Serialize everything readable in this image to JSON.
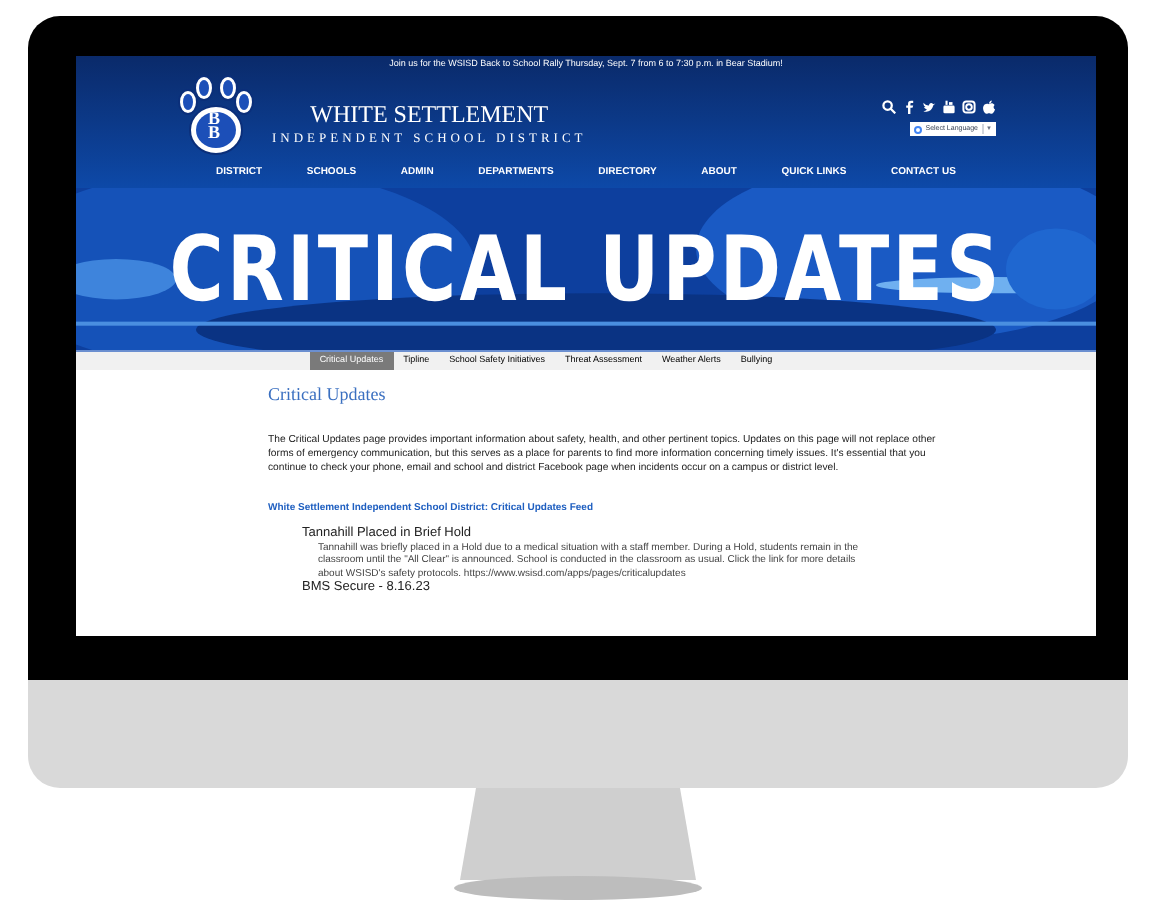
{
  "announcement": "Join us for the WSISD Back to School Rally Thursday, Sept. 7 from 6 to 7:30 p.m. in Bear Stadium!",
  "logo": {
    "letters": "BB"
  },
  "site_title": "WHITE SETTLEMENT",
  "site_subtitle": "INDEPENDENT SCHOOL DISTRICT",
  "language_select": {
    "value": "Select Language",
    "caret": "▼"
  },
  "nav": [
    "DISTRICT",
    "SCHOOLS",
    "ADMIN",
    "DEPARTMENTS",
    "DIRECTORY",
    "ABOUT",
    "QUICK LINKS",
    "CONTACT US"
  ],
  "hero_title": "CRITICAL UPDATES",
  "subnav": [
    {
      "label": "Critical Updates",
      "selected": true
    },
    {
      "label": "Tipline",
      "selected": false
    },
    {
      "label": "School Safety Initiatives",
      "selected": false
    },
    {
      "label": "Threat Assessment",
      "selected": false
    },
    {
      "label": "Weather Alerts",
      "selected": false
    },
    {
      "label": "Bullying",
      "selected": false
    }
  ],
  "page_heading": "Critical Updates",
  "intro": "The Critical Updates page provides important information about safety, health, and other pertinent topics. Updates on this page will not replace other forms of emergency communication, but this serves as a place for parents to find more information concerning timely issues. It's essential that you continue to check your phone, email and school and district Facebook page when incidents occur on a campus or district level.",
  "feed_title": "White Settlement Independent School District: Critical Updates Feed",
  "feed": [
    {
      "title": "Tannahill Placed in Brief Hold",
      "body": "Tannahill was briefly placed in a Hold due to a medical situation with a staff member. During a Hold, students remain in the classroom until the \"All Clear\" is announced. School is conducted in the classroom as usual. Click the link for more details about WSISD's safety protocols. https://www.wsisd.com/apps/pages/criticalupdates"
    },
    {
      "title": "BMS Secure - 8.16.23"
    }
  ]
}
